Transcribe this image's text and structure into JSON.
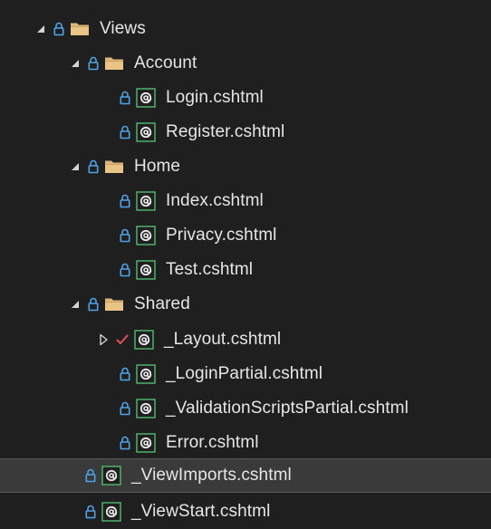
{
  "tree": {
    "rows": [
      {
        "label": "Views"
      },
      {
        "label": "Account"
      },
      {
        "label": "Login.cshtml"
      },
      {
        "label": "Register.cshtml"
      },
      {
        "label": "Home"
      },
      {
        "label": "Index.cshtml"
      },
      {
        "label": "Privacy.cshtml"
      },
      {
        "label": "Test.cshtml"
      },
      {
        "label": "Shared"
      },
      {
        "label": "_Layout.cshtml"
      },
      {
        "label": "_LoginPartial.cshtml"
      },
      {
        "label": "_ValidationScriptsPartial.cshtml"
      },
      {
        "label": "Error.cshtml"
      },
      {
        "label": "_ViewImports.cshtml"
      },
      {
        "label": "_ViewStart.cshtml"
      }
    ],
    "selected": "_ViewImports.cshtml"
  },
  "colors": {
    "background": "#1f1f1f",
    "text": "#e6e6e6",
    "lock": "#4fa3e6",
    "folder": "#dcb67a",
    "cshtml_border": "#4fb06b",
    "check": "#e05252",
    "selection": "#3a3a3a"
  },
  "icons": {
    "expanded": "triangle-down-icon",
    "collapsed": "triangle-right-icon",
    "lock": "lock-icon",
    "folder": "folder-icon",
    "file": "cshtml-file-icon",
    "pending-edit": "checkmark-icon"
  }
}
